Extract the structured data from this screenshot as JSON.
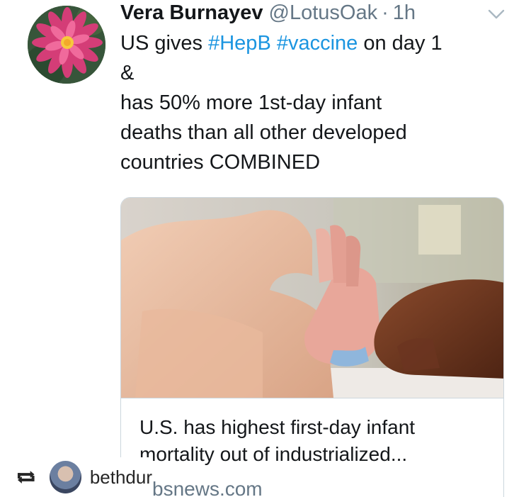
{
  "tweet": {
    "author_name": "Vera Burnayev",
    "handle": "@LotusOak",
    "separator": "·",
    "time": "1h",
    "text_lines": [
      {
        "plain_before": "US gives ",
        "hashtag1": "#HepB",
        "space": " ",
        "hashtag2": "#vaccine",
        "plain_after": " on day 1"
      },
      "&",
      "has 50% more 1st-day infant",
      "deaths than all other developed",
      "countries COMBINED"
    ]
  },
  "card": {
    "title_lines": [
      "U.S. has highest first-day infant",
      "mortality out of industrialized..."
    ],
    "domain": "bsnews.com"
  },
  "regram": {
    "username": "bethdur"
  },
  "icons": {
    "avatar": "lotus-flower-avatar",
    "menu": "chevron-down-icon",
    "regram": "repost-icon"
  },
  "colors": {
    "hashtag": "#1b95e0",
    "muted": "#657786",
    "text": "#14171a",
    "border": "#ccd6dd"
  }
}
